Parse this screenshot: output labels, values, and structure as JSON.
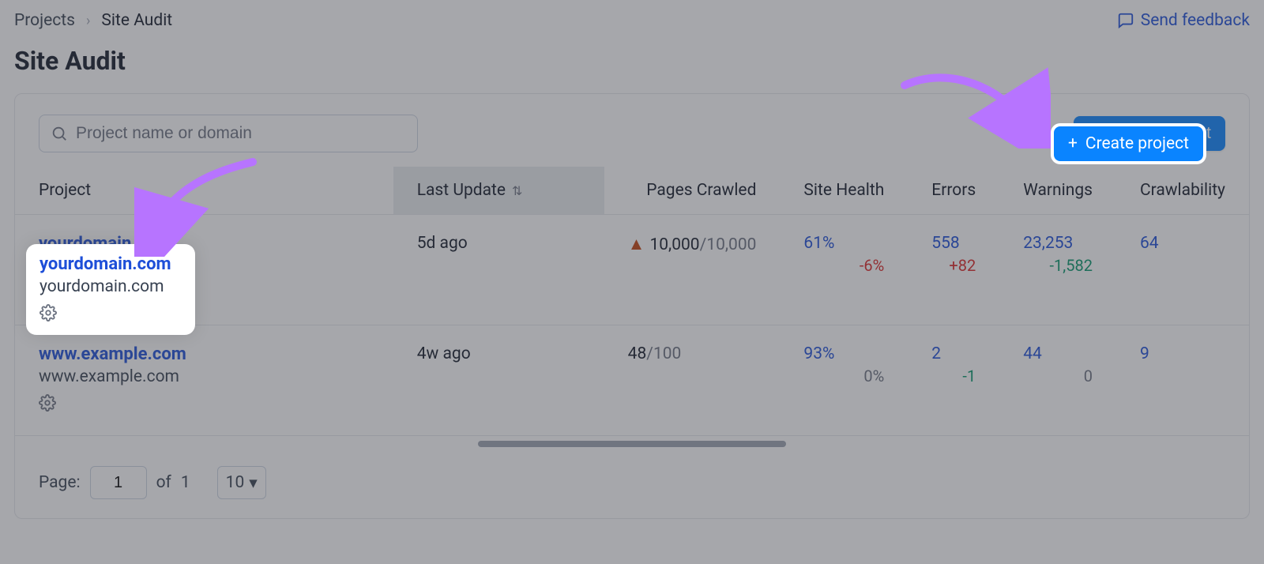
{
  "breadcrumbs": {
    "root": "Projects",
    "current": "Site Audit"
  },
  "feedback_label": "Send feedback",
  "page_title": "Site Audit",
  "search": {
    "placeholder": "Project name or domain"
  },
  "create_button": "Create project",
  "columns": {
    "project": "Project",
    "last_update": "Last Update",
    "pages_crawled": "Pages Crawled",
    "site_health": "Site Health",
    "errors": "Errors",
    "warnings": "Warnings",
    "crawlability": "Crawlability"
  },
  "rows": [
    {
      "name": "yourdomain.com",
      "domain": "yourdomain.com",
      "last_update": "5d ago",
      "pages_crawled_used": "10,000",
      "pages_crawled_total": "10,000",
      "pages_crawled_warn": true,
      "site_health": "61%",
      "site_health_delta": "-6%",
      "site_health_delta_sign": "neg",
      "errors": "558",
      "errors_delta": "+82",
      "errors_delta_sign": "neg",
      "warnings": "23,253",
      "warnings_delta": "-1,582",
      "warnings_delta_sign": "pos",
      "crawlability": "64"
    },
    {
      "name": "www.example.com",
      "domain": "www.example.com",
      "last_update": "4w ago",
      "pages_crawled_used": "48",
      "pages_crawled_total": "100",
      "pages_crawled_warn": false,
      "site_health": "93%",
      "site_health_delta": "0%",
      "site_health_delta_sign": "neutral",
      "errors": "2",
      "errors_delta": "-1",
      "errors_delta_sign": "pos",
      "warnings": "44",
      "warnings_delta": "0",
      "warnings_delta_sign": "neutral",
      "crawlability": "9"
    }
  ],
  "pager": {
    "label": "Page:",
    "current": "1",
    "of_label": "of",
    "total": "1",
    "page_size": "10"
  }
}
